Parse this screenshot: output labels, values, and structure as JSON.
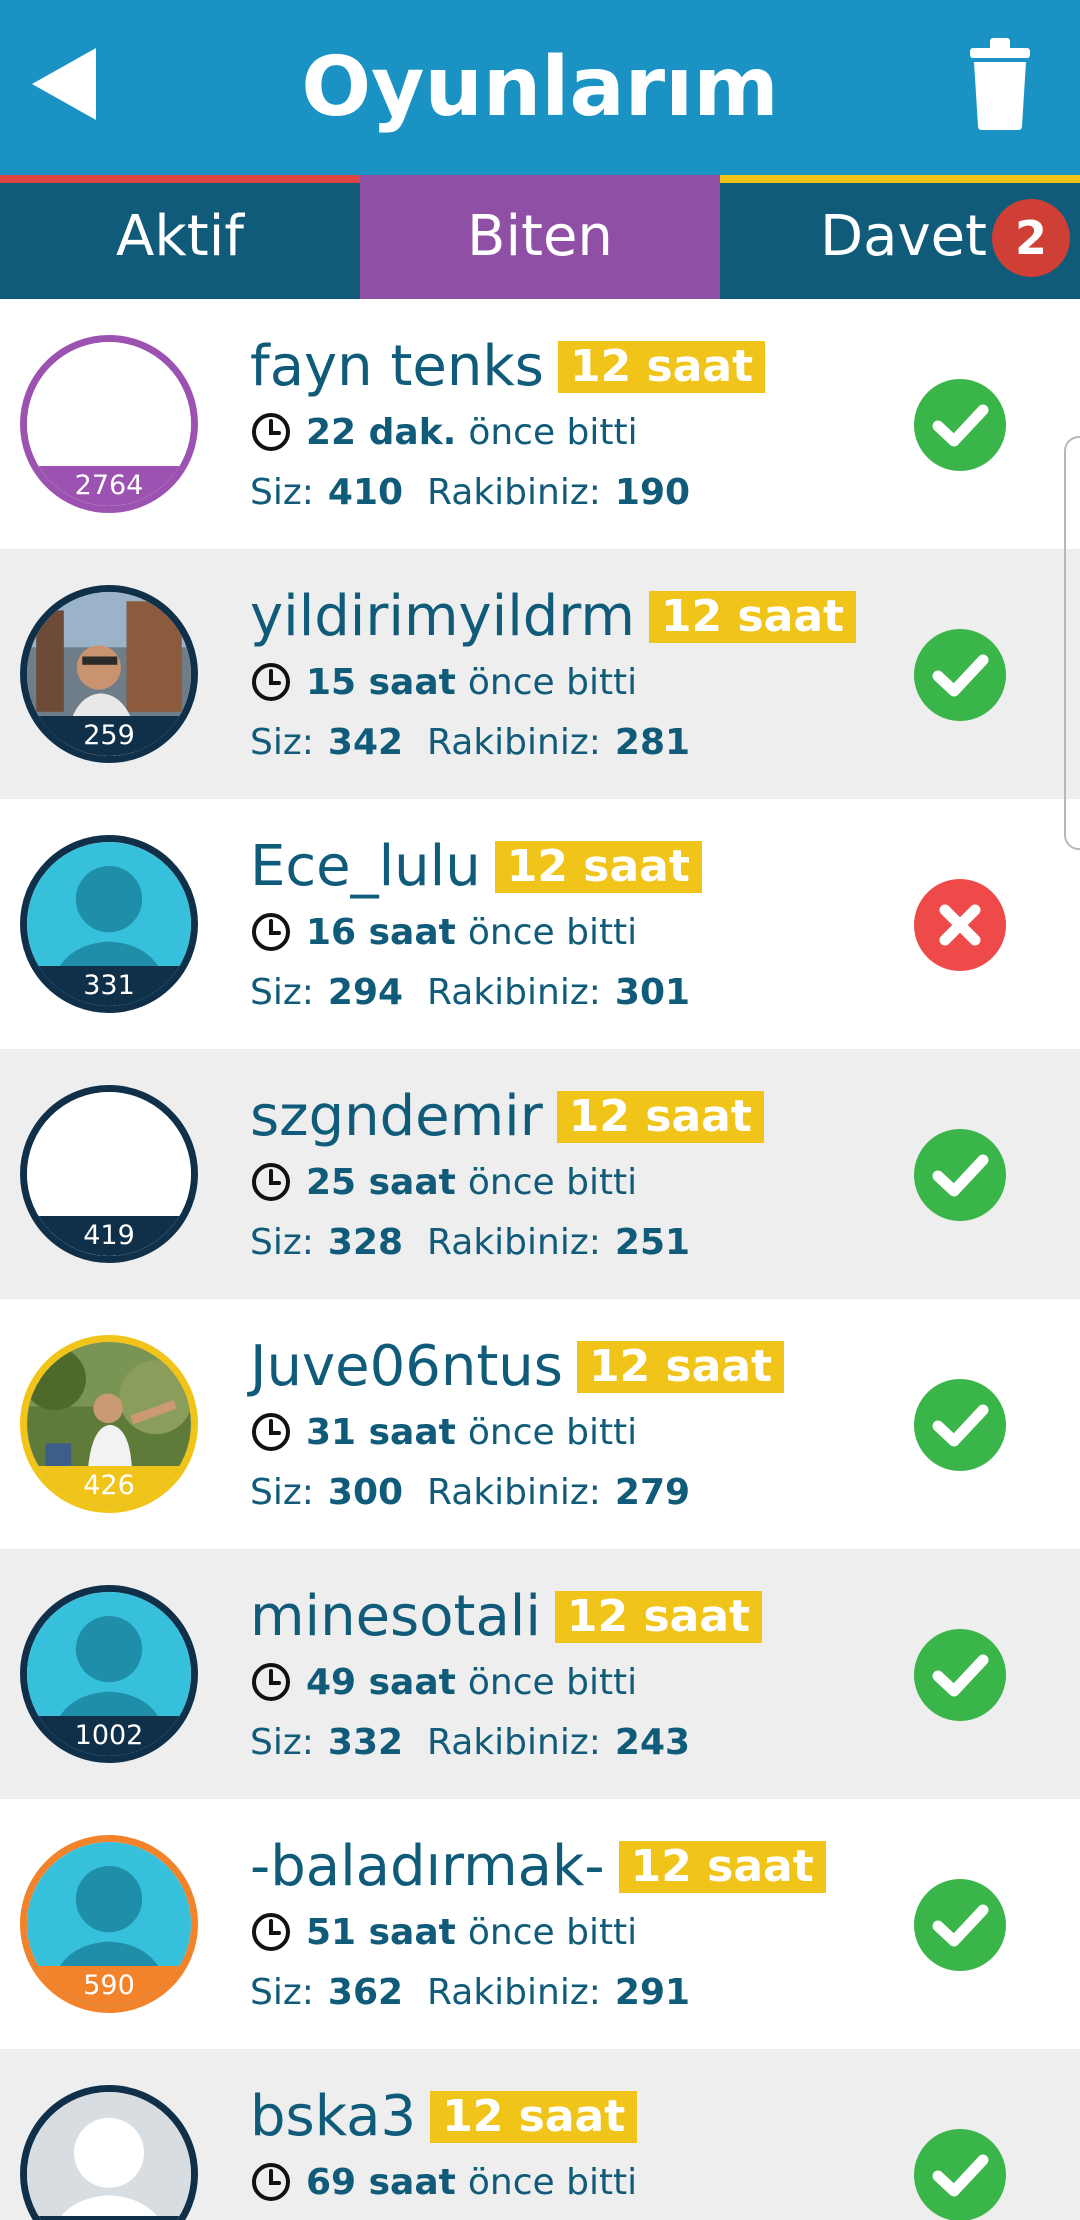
{
  "header": {
    "title": "Oyunlarım"
  },
  "tabs": [
    {
      "label": "Aktif"
    },
    {
      "label": "Biten"
    },
    {
      "label": "Davet",
      "badge": "2"
    }
  ],
  "labels": {
    "you": "Siz:",
    "opponent": "Rakibiniz:",
    "ago_suffix": "önce bitti"
  },
  "colors": {
    "header": "#1a93c4",
    "tabbar": "#0f5b79",
    "active_tab": "#8e4fa5",
    "time_badge": "#f0c419",
    "win": "#3ab54a",
    "loss": "#ee4a4a"
  },
  "games": [
    {
      "name": "fayn tenks",
      "badge": "12 saat",
      "ago": "22 dak.",
      "you": "410",
      "opp": "190",
      "rating": "2764",
      "result": "win",
      "ring": "#9b52b0",
      "photo": "blank"
    },
    {
      "name": "yildirimyildrm",
      "badge": "12 saat",
      "ago": "15 saat",
      "you": "342",
      "opp": "281",
      "rating": "259",
      "result": "win",
      "ring": "#10304a",
      "photo": "photo"
    },
    {
      "name": "Ece_lulu",
      "badge": "12 saat",
      "ago": "16 saat",
      "you": "294",
      "opp": "301",
      "rating": "331",
      "result": "loss",
      "ring": "#10304a",
      "photo": "silhouette"
    },
    {
      "name": "szgndemir",
      "badge": "12 saat",
      "ago": "25 saat",
      "you": "328",
      "opp": "251",
      "rating": "419",
      "result": "win",
      "ring": "#10304a",
      "photo": "blank"
    },
    {
      "name": "Juve06ntus",
      "badge": "12 saat",
      "ago": "31 saat",
      "you": "300",
      "opp": "279",
      "rating": "426",
      "result": "win",
      "ring": "#f0c419",
      "photo": "photo2"
    },
    {
      "name": "minesotali",
      "badge": "12 saat",
      "ago": "49 saat",
      "you": "332",
      "opp": "243",
      "rating": "1002",
      "result": "win",
      "ring": "#10304a",
      "photo": "silhouette"
    },
    {
      "name": "-baladırmak-",
      "badge": "12 saat",
      "ago": "51 saat",
      "you": "362",
      "opp": "291",
      "rating": "590",
      "result": "win",
      "ring": "#f2832a",
      "photo": "silhouette"
    },
    {
      "name": "bska3",
      "badge": "12 saat",
      "ago": "69 saat",
      "you": "",
      "opp": "",
      "rating": "",
      "result": "win",
      "ring": "#10304a",
      "photo": "grey"
    }
  ]
}
